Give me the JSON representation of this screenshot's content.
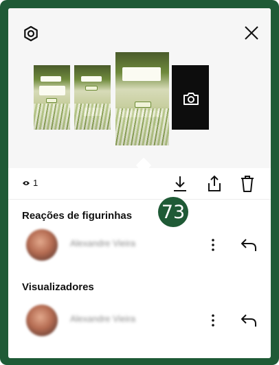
{
  "header": {
    "settings_icon": "settings-gear-icon",
    "close_icon": "close-x-icon"
  },
  "story_thumbnails": [
    {
      "label": "story-1"
    },
    {
      "label": "story-2"
    },
    {
      "label": "story-3-selected"
    },
    {
      "label": "add-new-camera"
    }
  ],
  "actions": {
    "viewers_count": "1",
    "download_icon": "download-icon",
    "share_icon": "share-icon",
    "delete_icon": "trash-icon"
  },
  "annotation": {
    "number": "73",
    "color": "#1f5a36"
  },
  "sections": {
    "reactions_title": "Reações de figurinhas",
    "viewers_title": "Visualizadores"
  },
  "users": [
    {
      "name": "Alexandre Vieira"
    },
    {
      "name": "Alexandre Vieira"
    }
  ],
  "colors": {
    "frame": "#1f5a36",
    "background": "#ffffff",
    "text": "#111111"
  }
}
